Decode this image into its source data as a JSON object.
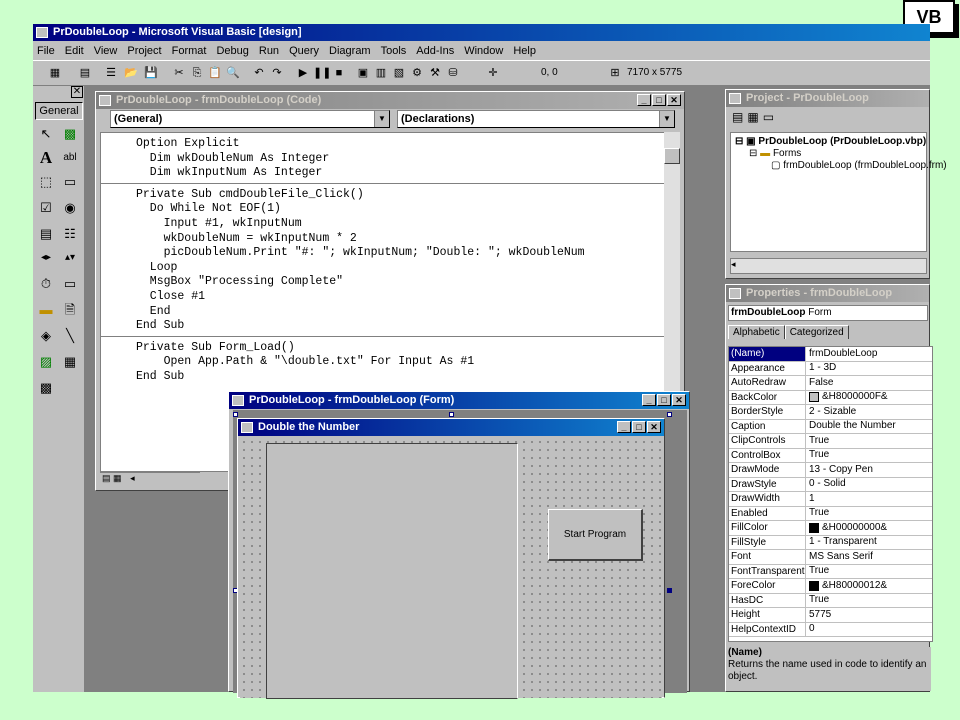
{
  "badge": "VB",
  "app": {
    "title": "PrDoubleLoop - Microsoft Visual Basic [design]",
    "menu": [
      "File",
      "Edit",
      "View",
      "Project",
      "Format",
      "Debug",
      "Run",
      "Query",
      "Diagram",
      "Tools",
      "Add-Ins",
      "Window",
      "Help"
    ],
    "toolbar": {
      "coords": "0, 0",
      "size": "7170 x 5775"
    }
  },
  "toolbox": {
    "tab": "General"
  },
  "code_window": {
    "title": "PrDoubleLoop - frmDoubleLoop (Code)",
    "object_combo": "(General)",
    "proc_combo": "(Declarations)",
    "sections": [
      [
        "Option Explicit",
        "  Dim wkDoubleNum As Integer",
        "  Dim wkInputNum As Integer"
      ],
      [
        "Private Sub cmdDoubleFile_Click()",
        "  Do While Not EOF(1)",
        "    Input #1, wkInputNum",
        "    wkDoubleNum = wkInputNum * 2",
        "    picDoubleNum.Print \"#: \"; wkInputNum; \"Double: \"; wkDoubleNum",
        "  Loop",
        "  MsgBox \"Processing Complete\"",
        "  Close #1",
        "  End",
        "End Sub"
      ],
      [
        "Private Sub Form_Load()",
        "    Open App.Path & \"\\double.txt\" For Input As #1",
        "End Sub"
      ]
    ]
  },
  "project_window": {
    "title": "Project - PrDoubleLoop",
    "root": "PrDoubleLoop (PrDoubleLoop.vbp)",
    "folder": "Forms",
    "item": "frmDoubleLoop (frmDoubleLoop.frm)"
  },
  "properties_window": {
    "title": "Properties - frmDoubleLoop",
    "object": "frmDoubleLoop",
    "object_type": "Form",
    "tabs": [
      "Alphabetic",
      "Categorized"
    ],
    "rows": [
      {
        "name": "(Name)",
        "value": "frmDoubleLoop"
      },
      {
        "name": "Appearance",
        "value": "1 - 3D"
      },
      {
        "name": "AutoRedraw",
        "value": "False"
      },
      {
        "name": "BackColor",
        "value": "&H8000000F&",
        "swatch": "#c0c0c0"
      },
      {
        "name": "BorderStyle",
        "value": "2 - Sizable"
      },
      {
        "name": "Caption",
        "value": "Double the Number"
      },
      {
        "name": "ClipControls",
        "value": "True"
      },
      {
        "name": "ControlBox",
        "value": "True"
      },
      {
        "name": "DrawMode",
        "value": "13 - Copy Pen"
      },
      {
        "name": "DrawStyle",
        "value": "0 - Solid"
      },
      {
        "name": "DrawWidth",
        "value": "1"
      },
      {
        "name": "Enabled",
        "value": "True"
      },
      {
        "name": "FillColor",
        "value": "&H00000000&",
        "swatch": "#000000"
      },
      {
        "name": "FillStyle",
        "value": "1 - Transparent"
      },
      {
        "name": "Font",
        "value": "MS Sans Serif"
      },
      {
        "name": "FontTransparent",
        "value": "True"
      },
      {
        "name": "ForeColor",
        "value": "&H80000012&",
        "swatch": "#000000"
      },
      {
        "name": "HasDC",
        "value": "True"
      },
      {
        "name": "Height",
        "value": "5775"
      },
      {
        "name": "HelpContextID",
        "value": "0"
      }
    ],
    "desc_title": "(Name)",
    "desc_text": "Returns the name used in code to identify an object."
  },
  "form_window": {
    "title": "PrDoubleLoop - frmDoubleLoop (Form)",
    "form_caption": "Double the Number",
    "button_label": "Start Program"
  }
}
